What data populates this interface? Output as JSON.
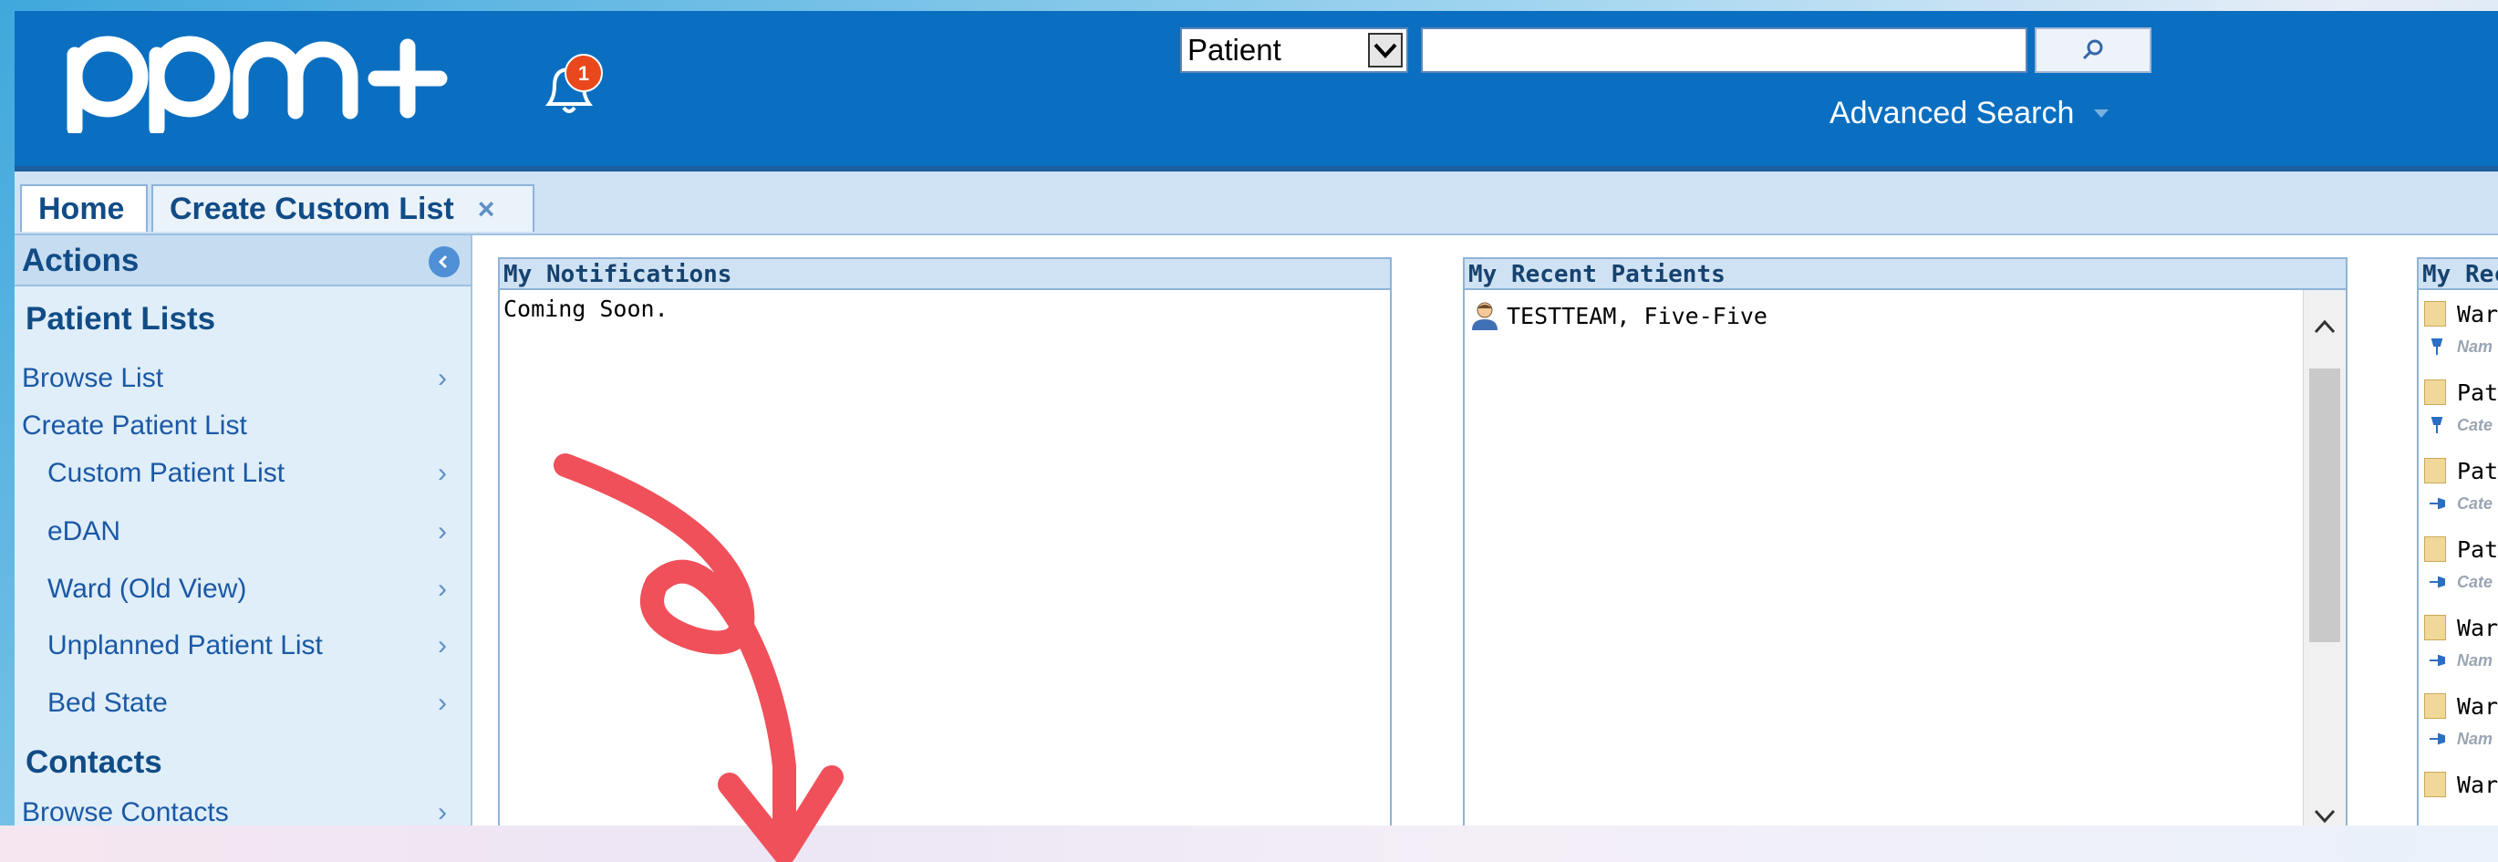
{
  "header": {
    "logo_text": "ppm+",
    "notification_count": "1",
    "search_type_value": "Patient",
    "search_query_value": "",
    "search_button_icon": "search-icon",
    "advanced_search_label": "Advanced Search"
  },
  "tabs": [
    {
      "label": "Home",
      "active": true
    },
    {
      "label": "Create Custom List",
      "closable": true,
      "close_glyph": "×"
    }
  ],
  "sidebar": {
    "header": "Actions",
    "sections": [
      {
        "title": "Patient Lists"
      },
      {
        "title": "Contacts"
      }
    ],
    "items": [
      {
        "label": "Browse List"
      },
      {
        "label": "Create Patient List"
      },
      {
        "label": "Custom Patient List"
      },
      {
        "label": "eDAN"
      },
      {
        "label": "Ward (Old View)"
      },
      {
        "label": "Unplanned Patient List"
      },
      {
        "label": "Bed State"
      },
      {
        "label": "Browse Contacts"
      }
    ]
  },
  "panels": {
    "notifications": {
      "title": "My Notifications",
      "body": "Coming Soon."
    },
    "recent_patients": {
      "title": "My Recent Patients",
      "patients": [
        {
          "name": "TESTTEAM, Five-Five"
        }
      ]
    },
    "recent_lists": {
      "title": "My Rec",
      "items": [
        {
          "title": "War",
          "sub": "Nam"
        },
        {
          "title": "Pati",
          "sub": "Cate"
        },
        {
          "title": "Pati",
          "sub": "Cate"
        },
        {
          "title": "Pati",
          "sub": "Cate"
        },
        {
          "title": "War",
          "sub": "Nam"
        },
        {
          "title": "War",
          "sub": "Nam"
        },
        {
          "title": "War",
          "sub": ""
        }
      ]
    }
  },
  "colors": {
    "header_blue": "#0b6fc1",
    "tab_bar": "#cfe2f3",
    "sidebar_bg": "#dfeef9",
    "badge_orange": "#e8481c",
    "annotation_red": "#f0505a"
  }
}
